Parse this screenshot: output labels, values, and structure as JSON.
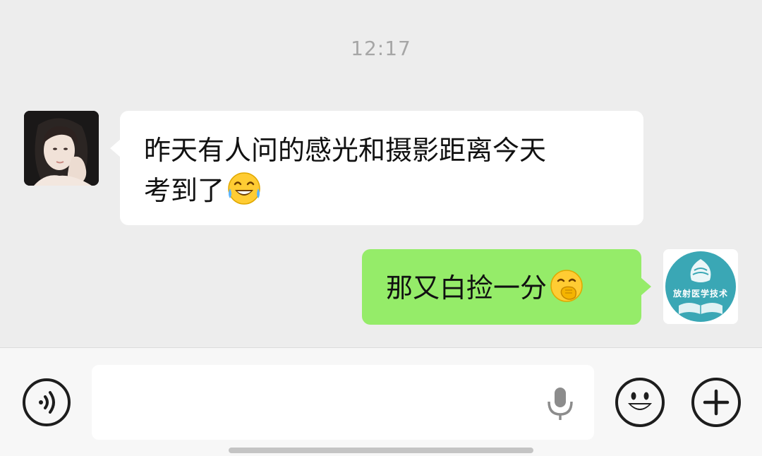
{
  "chat": {
    "timestamp": "12:17",
    "messages": [
      {
        "sender": "contact",
        "line1": "昨天有人问的感光和摄影距离今天",
        "line2": "考到了",
        "emoji": "tears-of-joy-emoji"
      },
      {
        "sender": "me",
        "text": "那又白捡一分",
        "emoji": "hand-over-mouth-emoji",
        "avatar_text": "放射医学技术"
      }
    ]
  },
  "input_bar": {
    "value": "",
    "icons": [
      "voice-mode-icon",
      "microphone-icon",
      "emoji-face-icon",
      "plus-icon"
    ]
  },
  "colors": {
    "background": "#ededed",
    "incoming_bubble": "#ffffff",
    "outgoing_bubble": "#95ec69",
    "avatar_logo_teal": "#3aa7b5"
  }
}
